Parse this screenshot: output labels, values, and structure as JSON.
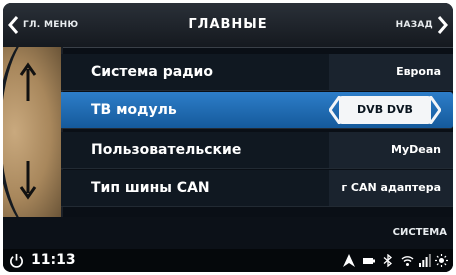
{
  "header": {
    "back_menu_label": "ГЛ. МЕНЮ",
    "title": "ГЛАВНЫЕ",
    "back_label": "НАЗАД"
  },
  "settings": [
    {
      "label": "Система радио",
      "value": "Европа"
    },
    {
      "label": "ТВ модуль",
      "value": "DVB DVB",
      "selected": true
    },
    {
      "label": "Пользовательские",
      "value": "MyDean"
    },
    {
      "label": "Тип шины CAN",
      "value": "г CAN адаптера"
    }
  ],
  "footer": {
    "system_label": "СИСТЕМА"
  },
  "status_bar": {
    "time": "11:13",
    "icons": [
      "navigation-icon",
      "battery-icon",
      "bluetooth-icon",
      "wifi-icon",
      "signal-icon",
      "brightness-icon"
    ]
  },
  "colors": {
    "selected_row": "#1f6db5",
    "background": "#0a0f16",
    "scroll_panel": "#b8966a"
  }
}
